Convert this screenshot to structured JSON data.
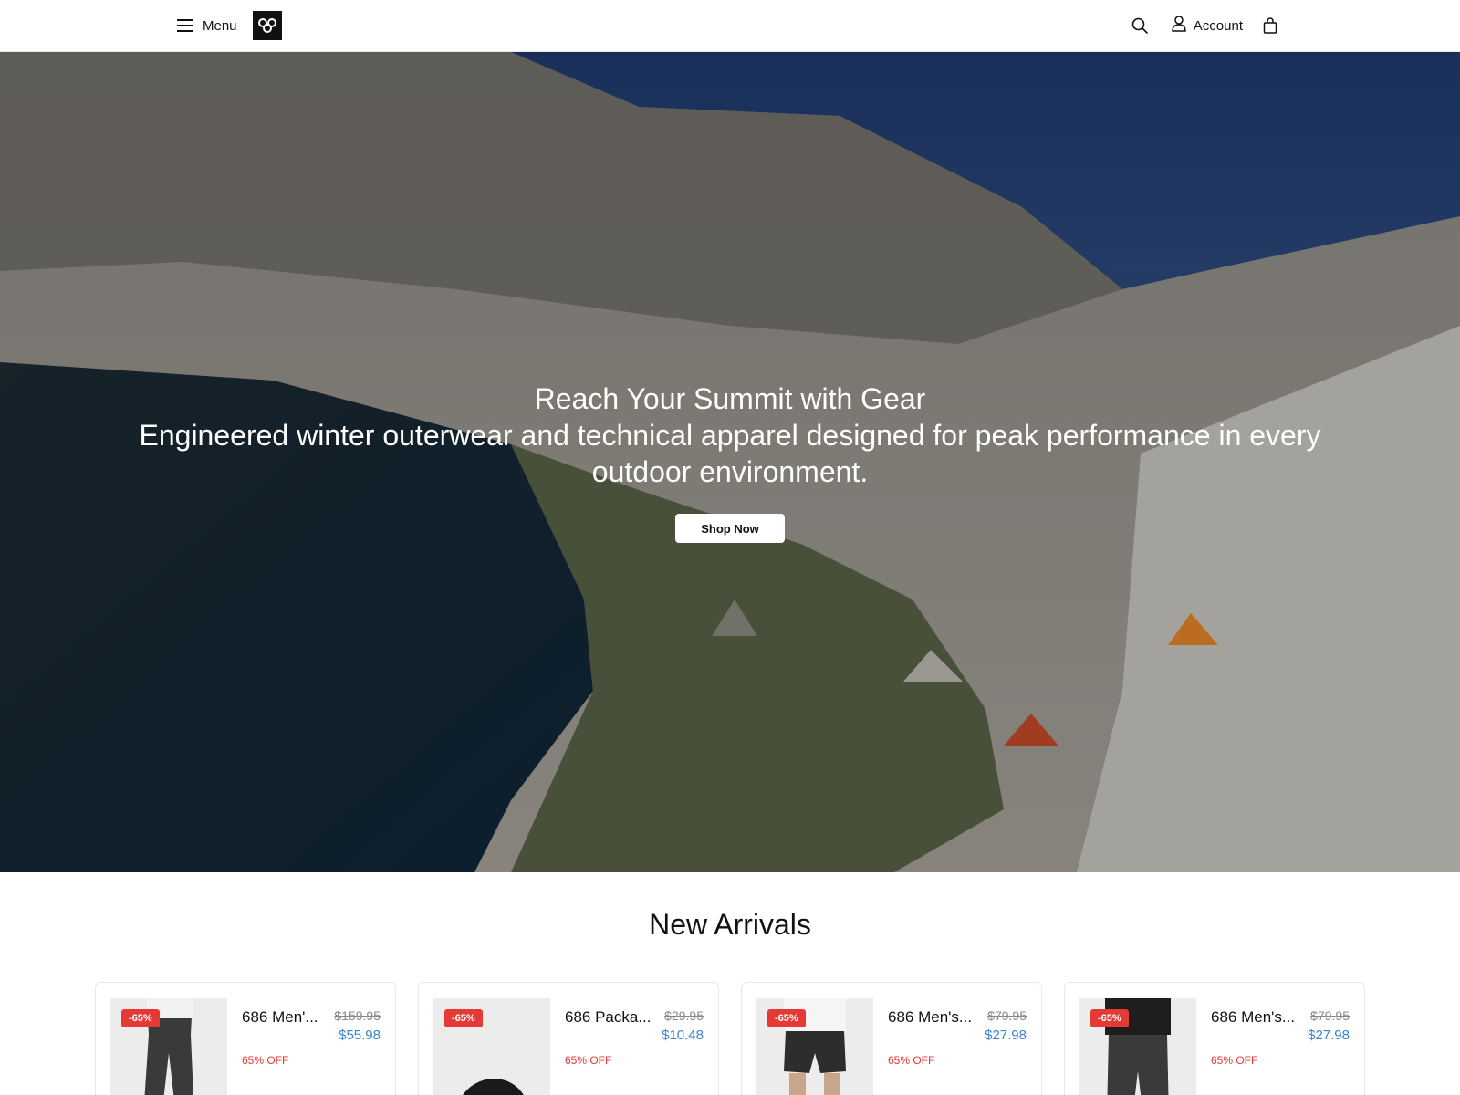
{
  "header": {
    "menu_label": "Menu",
    "account_label": "Account",
    "icons": [
      "hamburger-icon",
      "brand-logo",
      "search-icon",
      "user-icon",
      "shopping-bag-icon"
    ]
  },
  "hero": {
    "title": "Reach Your Summit with Gear",
    "subtitle": "Engineered winter outerwear and technical apparel designed for peak performance in every outdoor environment.",
    "cta_label": "Shop Now"
  },
  "new_arrivals": {
    "title": "New Arrivals",
    "products": [
      {
        "badge": "-65%",
        "name": "686 Men'...",
        "price_old": "$159.95",
        "price_new": "$55.98",
        "discount": "65% OFF"
      },
      {
        "badge": "-65%",
        "name": "686 Packa...",
        "price_old": "$29.95",
        "price_new": "$10.48",
        "discount": "65% OFF"
      },
      {
        "badge": "-65%",
        "name": "686 Men's...",
        "price_old": "$79.95",
        "price_new": "$27.98",
        "discount": "65% OFF"
      },
      {
        "badge": "-65%",
        "name": "686 Men's...",
        "price_old": "$79.95",
        "price_new": "$27.98",
        "discount": "65% OFF"
      }
    ]
  },
  "colors": {
    "accent_price": "#3b82d6",
    "badge": "#e53935",
    "text": "#111111"
  }
}
